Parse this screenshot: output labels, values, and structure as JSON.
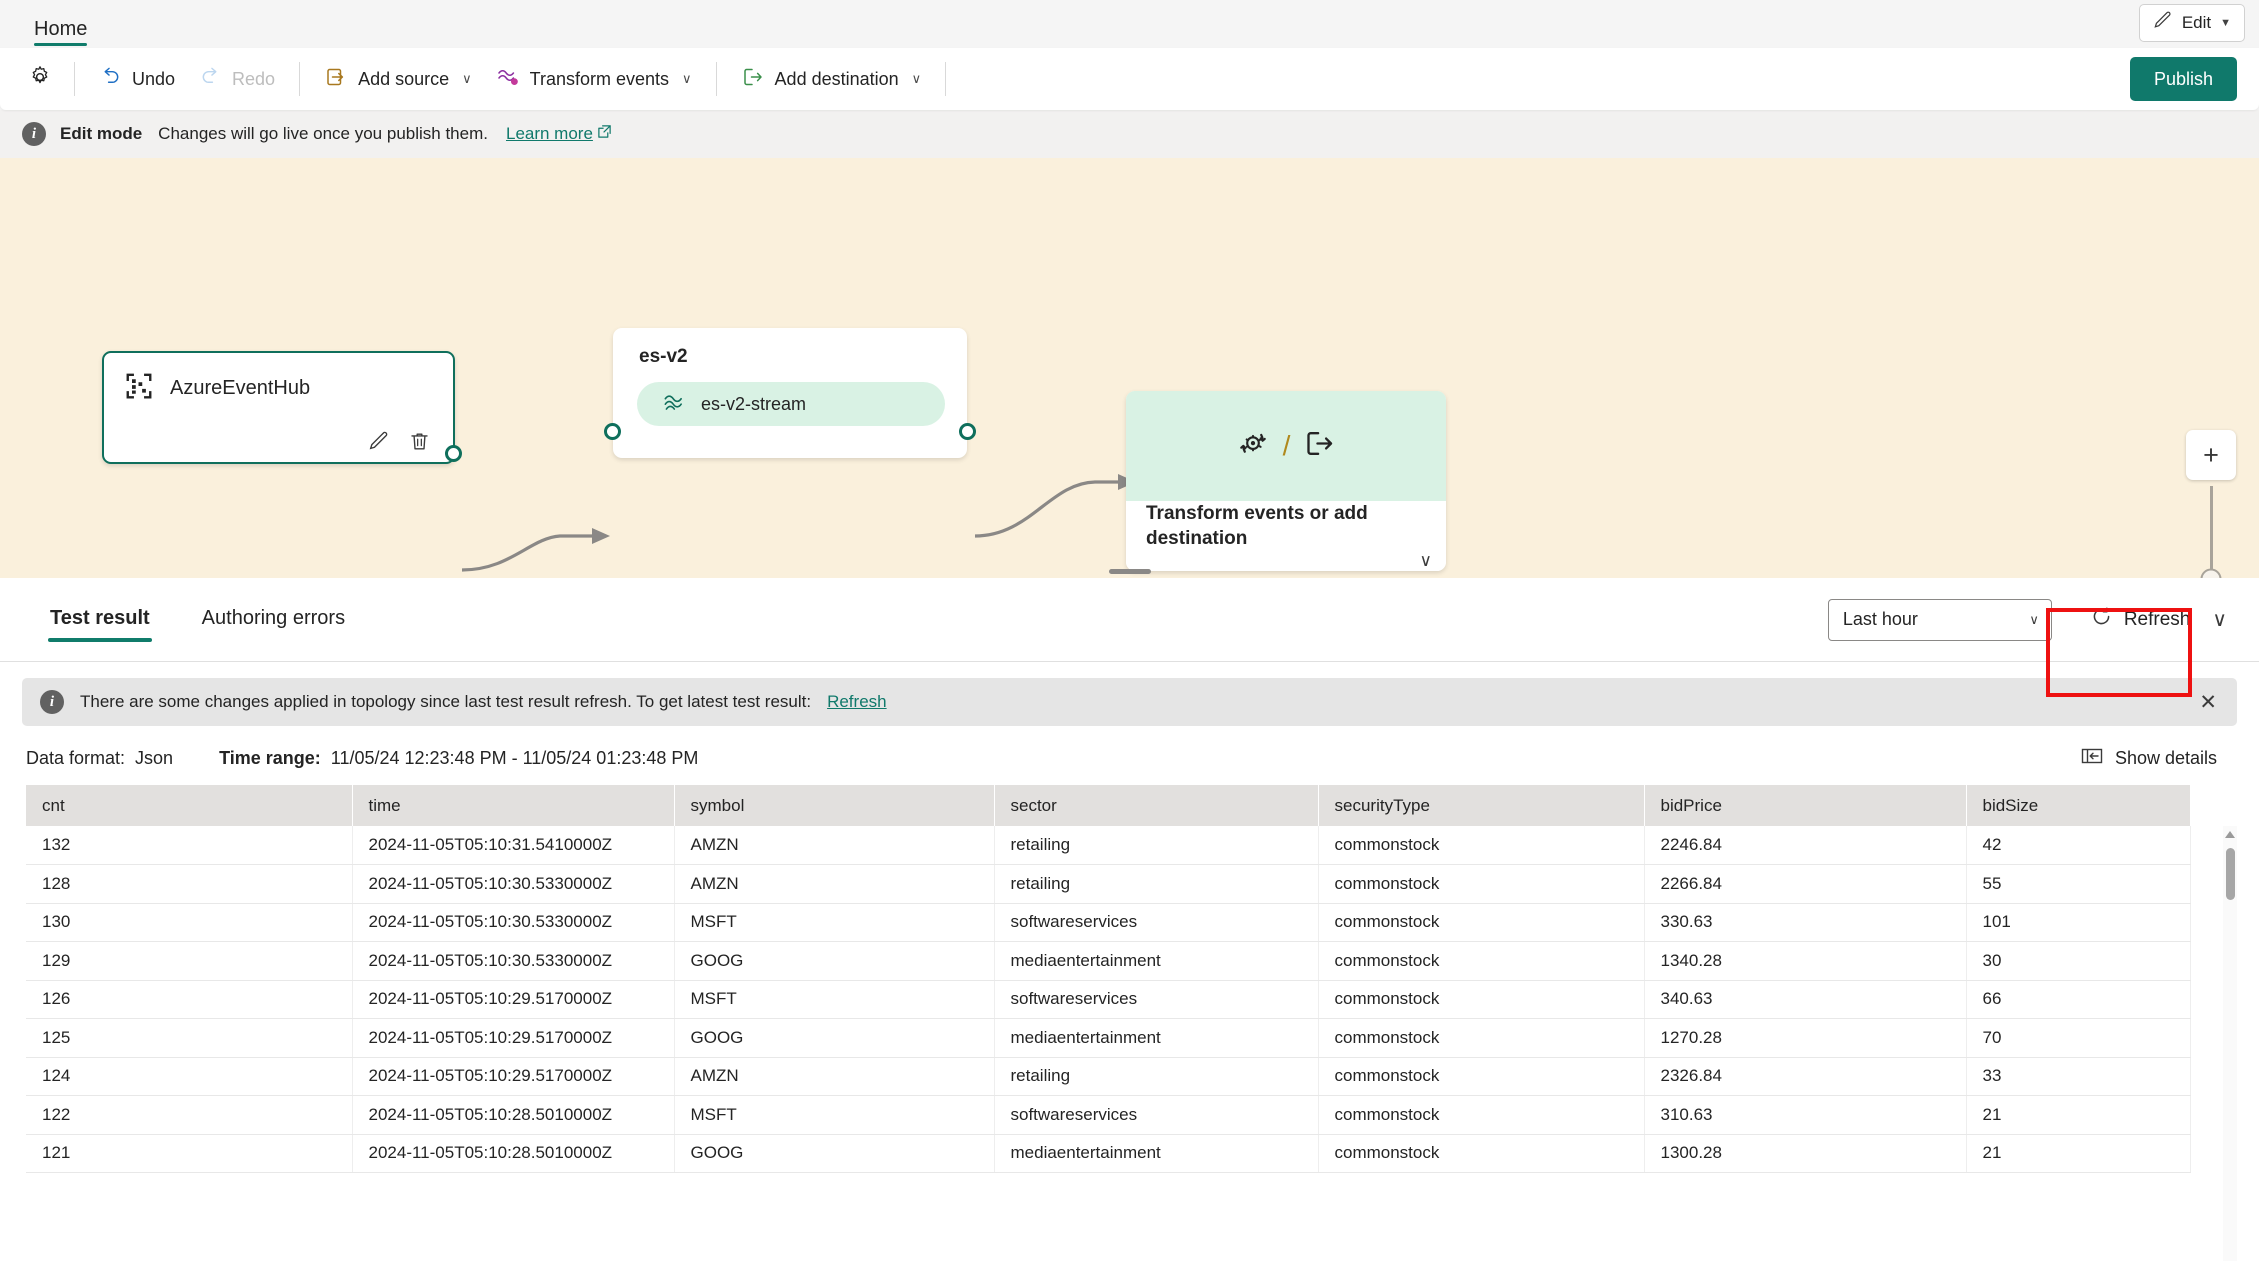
{
  "window": {
    "top_accent_color": "#e8a87c"
  },
  "ribbon": {
    "tabs": [
      {
        "label": "Home",
        "active": true
      }
    ],
    "edit_button": {
      "label": "Edit",
      "icon": "pencil-icon",
      "caret": "▼"
    }
  },
  "commandbar": {
    "settings_icon": "gear-icon",
    "buttons": [
      {
        "label": "Undo",
        "icon": "undo-icon",
        "disabled": false
      },
      {
        "label": "Redo",
        "icon": "redo-icon",
        "disabled": true
      },
      {
        "label": "Add source",
        "icon": "add-source-icon",
        "caret": "∨",
        "disabled": false
      },
      {
        "label": "Transform events",
        "icon": "transform-events-icon",
        "caret": "∨",
        "disabled": false
      },
      {
        "label": "Add destination",
        "icon": "add-destination-icon",
        "caret": "∨",
        "disabled": false
      }
    ],
    "publish_label": "Publish",
    "publish_color": "#10796b"
  },
  "edit_banner": {
    "icon": "info-icon",
    "title": "Edit mode",
    "message": "Changes will go live once you publish them.",
    "link": "Learn more",
    "link_icon": "external-link-icon"
  },
  "canvas": {
    "background_color": "#faf0dc",
    "source_node": {
      "label": "AzureEventHub",
      "icon": "eventhub-icon",
      "edit_icon": "pencil-icon",
      "delete_icon": "trash-icon",
      "border_color": "#0f6f5c"
    },
    "stream_node": {
      "title": "es-v2",
      "pill_label": "es-v2-stream",
      "pill_icon": "eventstream-icon",
      "pill_color": "#d9f2e4"
    },
    "transform_node": {
      "icon_left": "transform-icon",
      "separator": "/",
      "icon_right": "destination-icon",
      "label": "Transform events or add destination",
      "caret": "∨",
      "header_color": "#d9f2e4"
    },
    "zoom_controls": {
      "zoom_in": "+",
      "zoom_out": "—",
      "slider_icon": "zoom-slider-thumb"
    },
    "resize_handle": "panel-drag-handle"
  },
  "panel": {
    "tabs": [
      {
        "label": "Test result",
        "active": true
      },
      {
        "label": "Authoring errors",
        "active": false
      }
    ],
    "time_range_selector": {
      "value": "Last hour",
      "caret": "∨"
    },
    "refresh_button": {
      "label": "Refresh",
      "icon": "refresh-icon"
    },
    "refresh_split_caret": "∨",
    "highlight_color": "#ee1111",
    "notice": {
      "icon": "info-icon",
      "message": "There are some changes applied in topology since last test result refresh. To get latest test result:",
      "link": "Refresh",
      "close_icon": "close-icon"
    },
    "meta": {
      "data_format_label": "Data format:",
      "data_format_value": "Json",
      "time_range_label": "Time range:",
      "time_range_value": "11/05/24 12:23:48 PM - 11/05/24 01:23:48 PM",
      "show_details_label": "Show details",
      "show_details_icon": "panel-expand-icon"
    },
    "table": {
      "columns": [
        "cnt",
        "time",
        "symbol",
        "sector",
        "securityType",
        "bidPrice",
        "bidSize"
      ],
      "rows": [
        [
          "132",
          "2024-11-05T05:10:31.5410000Z",
          "AMZN",
          "retailing",
          "commonstock",
          "2246.84",
          "42"
        ],
        [
          "128",
          "2024-11-05T05:10:30.5330000Z",
          "AMZN",
          "retailing",
          "commonstock",
          "2266.84",
          "55"
        ],
        [
          "130",
          "2024-11-05T05:10:30.5330000Z",
          "MSFT",
          "softwareservices",
          "commonstock",
          "330.63",
          "101"
        ],
        [
          "129",
          "2024-11-05T05:10:30.5330000Z",
          "GOOG",
          "mediaentertainment",
          "commonstock",
          "1340.28",
          "30"
        ],
        [
          "126",
          "2024-11-05T05:10:29.5170000Z",
          "MSFT",
          "softwareservices",
          "commonstock",
          "340.63",
          "66"
        ],
        [
          "125",
          "2024-11-05T05:10:29.5170000Z",
          "GOOG",
          "mediaentertainment",
          "commonstock",
          "1270.28",
          "70"
        ],
        [
          "124",
          "2024-11-05T05:10:29.5170000Z",
          "AMZN",
          "retailing",
          "commonstock",
          "2326.84",
          "33"
        ],
        [
          "122",
          "2024-11-05T05:10:28.5010000Z",
          "MSFT",
          "softwareservices",
          "commonstock",
          "310.63",
          "21"
        ],
        [
          "121",
          "2024-11-05T05:10:28.5010000Z",
          "GOOG",
          "mediaentertainment",
          "commonstock",
          "1300.28",
          "21"
        ]
      ]
    }
  }
}
